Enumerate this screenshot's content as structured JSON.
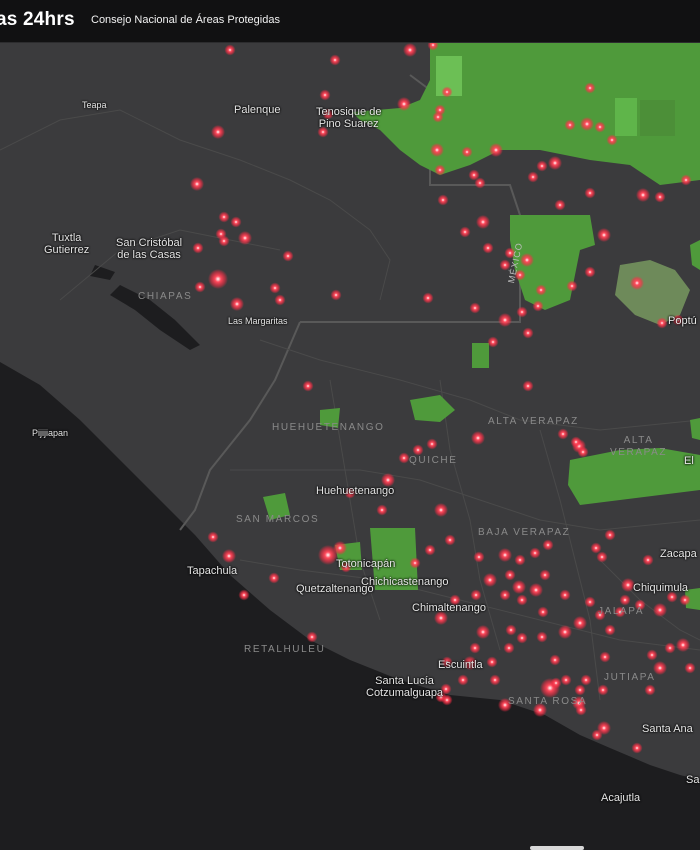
{
  "header": {
    "title": "as 24hrs",
    "subtitle": "Consejo Nacional de Áreas Protegidas"
  },
  "map": {
    "colors": {
      "land": "#3b3b3d",
      "ocean": "#1d1d1f",
      "protected_area": "#4f9a3b",
      "fire": "#ff3a4e"
    },
    "places": {
      "teapa": "Teapa",
      "palenque": "Palenque",
      "tenosique": "Tenosique de\nPino Suarez",
      "tuxtla": "Tuxtla\nGutierrez",
      "san_cristobal": "San Cristóbal\nde las Casas",
      "las_margaritas": "Las Margaritas",
      "poptun": "Poptú",
      "pijijiapan": "Pijijiapan",
      "huehuetenango_city": "Huehuetenango",
      "el": "El",
      "zacapa": "Zacapa",
      "totonicapan": "Totonicapán",
      "tapachula": "Tapachula",
      "chichicastenango": "Chichicastenango",
      "quetzaltenango": "Quetzaltenango",
      "chimaltenango": "Chimaltenango",
      "chiquimula": "Chiquimula",
      "escuintla": "Escuintla",
      "santa_lucia": "Santa Lucía\nCotzumalguapa",
      "santa_ana": "Santa Ana",
      "sa": "Sa",
      "acajutla": "Acajutla"
    },
    "regions": {
      "chiapas": "CHIAPAS",
      "huehuetenango": "HUEHUETENANGO",
      "quiche": "QUICHE",
      "alta_verapaz": "ALTA VERAPAZ",
      "alta_verapaz_2": "ALTA\nVERAPAZ",
      "san_marcos": "SAN MARCOS",
      "baja_verapaz": "BAJA VERAPAZ",
      "retalhuleu": "RETALHULEU",
      "jalapa": "JALAPA",
      "jutiapa": "JUTIAPA",
      "santa_rosa": "SANTA ROSA",
      "mexico": "MÉXICO"
    }
  }
}
